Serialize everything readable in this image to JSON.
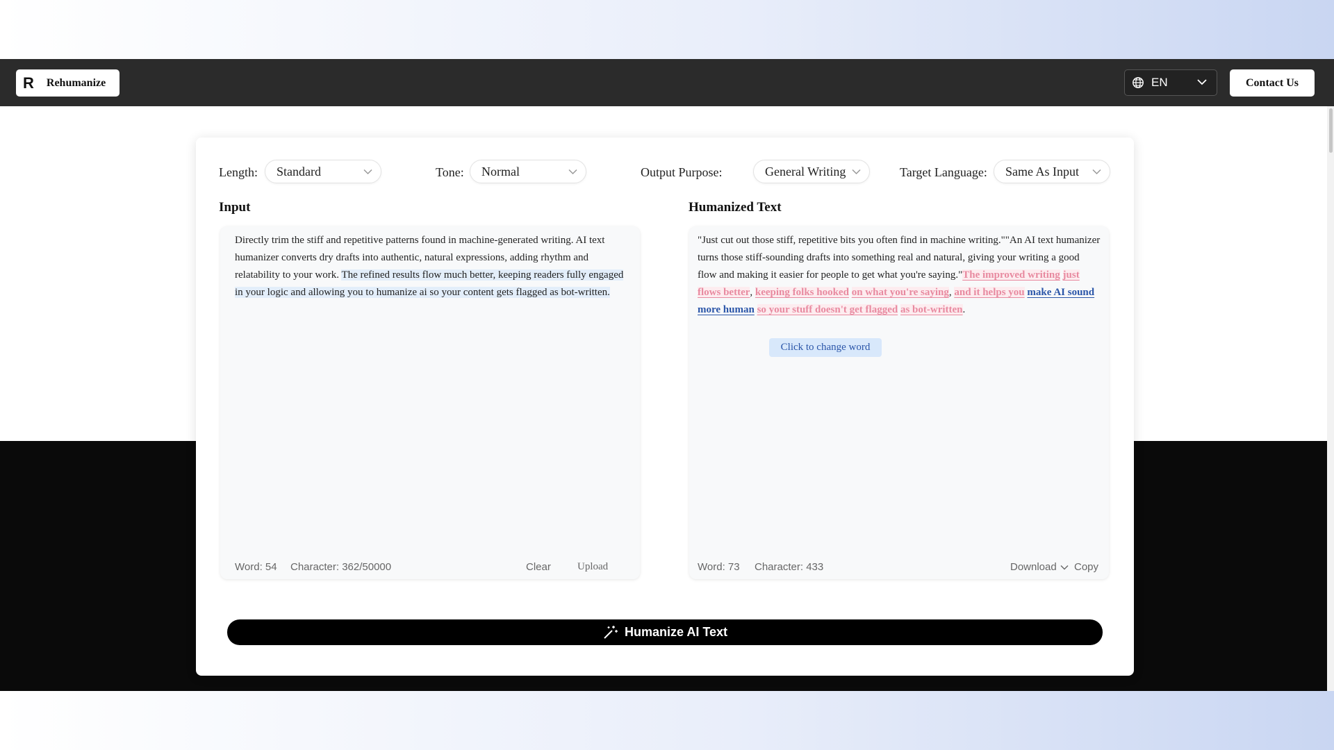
{
  "header": {
    "logo_glyph": "R",
    "brand": "Rehumanize",
    "language": "EN",
    "contact_label": "Contact Us"
  },
  "options": {
    "length": {
      "label": "Length:",
      "value": "Standard"
    },
    "tone": {
      "label": "Tone:",
      "value": "Normal"
    },
    "purpose": {
      "label": "Output Purpose:",
      "value": "General Writing"
    },
    "target_language": {
      "label": "Target Language:",
      "value": "Same As Input"
    }
  },
  "input": {
    "title": "Input",
    "text_plain": "Directly trim the stiff and repetitive patterns found in machine-generated writing. AI text humanizer converts dry drafts into authentic, natural expressions, adding rhythm and relatability to your work. ",
    "text_highlighted": "The refined results flow much better, keeping readers fully engaged in your logic and allowing you to humanize ai so your content gets flagged as bot-written.",
    "word_count": "Word: 54",
    "char_count": "Character: 362/50000",
    "clear_label": "Clear",
    "upload_label": "Upload"
  },
  "output": {
    "title": "Humanized Text",
    "text_plain": "\"Just cut out those stiff, repetitive bits you often find in machine writing.\"\"An AI text humanizer turns those stiff-sounding drafts into something real and natural, giving your writing a good flow and making it easier for people to get what you're saying.\"",
    "segments": [
      "The improved writing",
      "just flows better",
      "keeping folks hooked",
      "on what you're saying",
      "and it helps you",
      "make AI sound more human",
      "so your stuff doesn't get flagged",
      "as bot-written"
    ],
    "selected_segment": 5,
    "tooltip": "Click to change word",
    "word_count": "Word: 73",
    "char_count": "Character: 433",
    "download_label": "Download",
    "copy_label": "Copy"
  },
  "action": {
    "humanize_label": "Humanize AI Text"
  },
  "colors": {
    "navbar": "#2b2b2b",
    "highlight": "#e3eefa",
    "marked_pink": "#e88aa0",
    "selected_blue": "#2a55a8"
  }
}
